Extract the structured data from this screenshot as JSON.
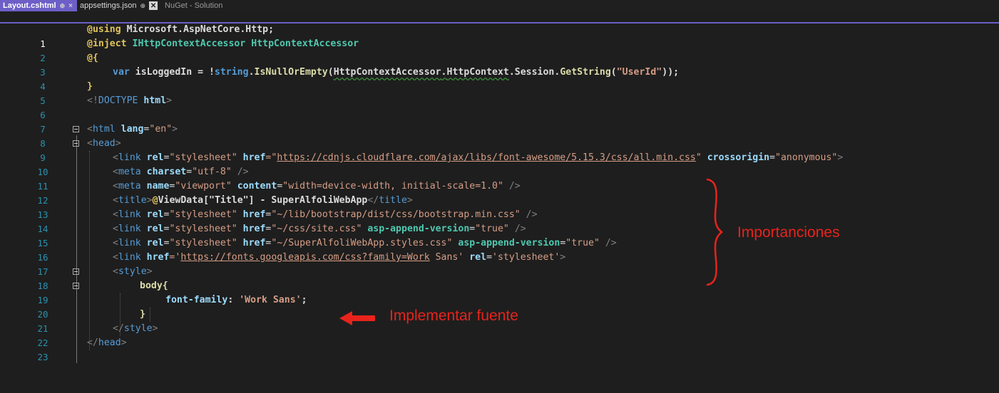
{
  "tabs": [
    {
      "label": "Layout.cshtml",
      "pin": "⊕",
      "close": "×",
      "active": true
    },
    {
      "label": "appsettings.json",
      "pin": "⊕",
      "close": "✕",
      "active": false
    },
    {
      "label": "NuGet - Solution",
      "active": false
    }
  ],
  "lines": [
    {
      "n": "1"
    },
    {
      "n": "2"
    },
    {
      "n": "3"
    },
    {
      "n": "4"
    },
    {
      "n": "5"
    },
    {
      "n": "6"
    },
    {
      "n": "7"
    },
    {
      "n": "8"
    },
    {
      "n": "9"
    },
    {
      "n": "10"
    },
    {
      "n": "11"
    },
    {
      "n": "12"
    },
    {
      "n": "13"
    },
    {
      "n": "14"
    },
    {
      "n": "15"
    },
    {
      "n": "16"
    },
    {
      "n": "17"
    },
    {
      "n": "18"
    },
    {
      "n": "19"
    },
    {
      "n": "20"
    },
    {
      "n": "21"
    },
    {
      "n": "22"
    },
    {
      "n": "23"
    }
  ],
  "code": {
    "l1": {
      "a": "@using",
      "b": " Microsoft.AspNetCore.Http;"
    },
    "l2": {
      "a": "@inject",
      "b": " IHttpContextAccessor HttpContextAccessor"
    },
    "l3": {
      "a": "@{"
    },
    "l4": {
      "a": "var",
      "b": " isLoggedIn = !",
      "c": "string",
      "d": ".",
      "e": "IsNullOrEmpty",
      "f": "(",
      "g": "HttpContextAccessor",
      "h": ".",
      "i": "HttpContext",
      "j": ".Session.",
      "k": "GetString",
      "l": "(",
      "m": "\"UserId\"",
      "n": "));"
    },
    "l5": {
      "a": "}"
    },
    "l6": {
      "a": "<!",
      "b": "DOCTYPE",
      "c": " html",
      "d": ">"
    },
    "l8": {
      "a": "<",
      "b": "html",
      "c": " lang",
      "d": "=",
      "e": "\"en\"",
      "f": ">"
    },
    "l9": {
      "a": "<",
      "b": "head",
      "c": ">"
    },
    "l10": {
      "a": "<",
      "b": "link",
      "c": " rel",
      "d": "=",
      "e": "\"stylesheet\"",
      "f": " href",
      "g": "=\"",
      "h": "https://cdnjs.cloudflare.com/ajax/libs/font-awesome/5.15.3/css/all.min.css",
      "i": "\"",
      "j": " crossorigin",
      "k": "=",
      "l": "\"anonymous\"",
      "m": ">"
    },
    "l11": {
      "a": "<",
      "b": "meta",
      "c": " charset",
      "d": "=",
      "e": "\"utf-8\"",
      "f": " />"
    },
    "l12": {
      "a": "<",
      "b": "meta",
      "c": " name",
      "d": "=",
      "e": "\"viewport\"",
      "f": " content",
      "g": "=",
      "h": "\"width=device-width, initial-scale=1.0\"",
      "i": " />"
    },
    "l13": {
      "a": "<",
      "b": "title",
      "c": ">",
      "d": "@",
      "e": "ViewData[\"Title\"] - SuperAlfoliWebApp",
      "f": "</",
      "g": "title",
      "h": ">"
    },
    "l14": {
      "a": "<",
      "b": "link",
      "c": " rel",
      "d": "=",
      "e": "\"stylesheet\"",
      "f": " href",
      "g": "=",
      "h": "\"~/lib/bootstrap/dist/css/bootstrap.min.css\"",
      "i": " />"
    },
    "l15": {
      "a": "<",
      "b": "link",
      "c": " rel",
      "d": "=",
      "e": "\"stylesheet\"",
      "f": " href",
      "g": "=",
      "h": "\"~/css/site.css\"",
      "i": " asp-append-version",
      "j": "=",
      "k": "\"true\"",
      "l": " />"
    },
    "l16": {
      "a": "<",
      "b": "link",
      "c": " rel",
      "d": "=",
      "e": "\"stylesheet\"",
      "f": " href",
      "g": "=",
      "h": "\"~/SuperAlfoliWebApp.styles.css\"",
      "i": " asp-append-version",
      "j": "=",
      "k": "\"true\"",
      "l": " />"
    },
    "l17": {
      "a": "<",
      "b": "link",
      "c": " href",
      "d": "='",
      "e": "https://fonts.googleapis.com/css?family=Work",
      "f": " Sans'",
      "g": " rel",
      "h": "=",
      "i": "'stylesheet'",
      "j": ">"
    },
    "l18": {
      "a": "<",
      "b": "style",
      "c": ">"
    },
    "l19": {
      "a": "body{"
    },
    "l20": {
      "a": "font-family",
      "b": ": ",
      "c": "'Work Sans'",
      "d": ";"
    },
    "l21": {
      "a": "}"
    },
    "l22": {
      "a": "</",
      "b": "style",
      "c": ">"
    },
    "l23": {
      "a": "</",
      "b": "head",
      "c": ">"
    }
  },
  "annotations": {
    "importaciones": "Importanciones",
    "fuente": "Implementar fuente"
  },
  "colors": {
    "accent": "#6c5fc7",
    "annotation": "#e8231c"
  }
}
